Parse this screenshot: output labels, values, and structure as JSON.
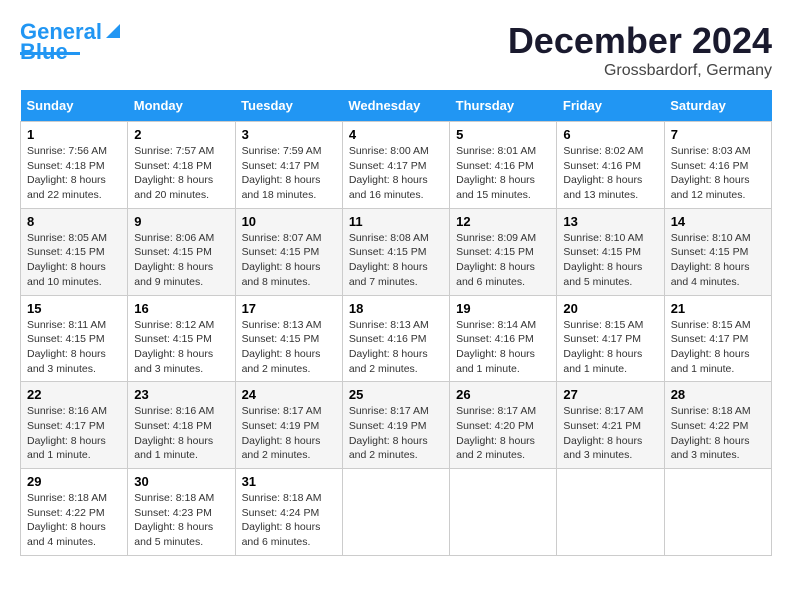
{
  "header": {
    "logo_line1": "General",
    "logo_line2": "Blue",
    "month": "December 2024",
    "location": "Grossbardorf, Germany"
  },
  "days_of_week": [
    "Sunday",
    "Monday",
    "Tuesday",
    "Wednesday",
    "Thursday",
    "Friday",
    "Saturday"
  ],
  "weeks": [
    [
      {
        "day": "1",
        "sunrise": "7:56 AM",
        "sunset": "4:18 PM",
        "daylight": "8 hours and 22 minutes."
      },
      {
        "day": "2",
        "sunrise": "7:57 AM",
        "sunset": "4:18 PM",
        "daylight": "8 hours and 20 minutes."
      },
      {
        "day": "3",
        "sunrise": "7:59 AM",
        "sunset": "4:17 PM",
        "daylight": "8 hours and 18 minutes."
      },
      {
        "day": "4",
        "sunrise": "8:00 AM",
        "sunset": "4:17 PM",
        "daylight": "8 hours and 16 minutes."
      },
      {
        "day": "5",
        "sunrise": "8:01 AM",
        "sunset": "4:16 PM",
        "daylight": "8 hours and 15 minutes."
      },
      {
        "day": "6",
        "sunrise": "8:02 AM",
        "sunset": "4:16 PM",
        "daylight": "8 hours and 13 minutes."
      },
      {
        "day": "7",
        "sunrise": "8:03 AM",
        "sunset": "4:16 PM",
        "daylight": "8 hours and 12 minutes."
      }
    ],
    [
      {
        "day": "8",
        "sunrise": "8:05 AM",
        "sunset": "4:15 PM",
        "daylight": "8 hours and 10 minutes."
      },
      {
        "day": "9",
        "sunrise": "8:06 AM",
        "sunset": "4:15 PM",
        "daylight": "8 hours and 9 minutes."
      },
      {
        "day": "10",
        "sunrise": "8:07 AM",
        "sunset": "4:15 PM",
        "daylight": "8 hours and 8 minutes."
      },
      {
        "day": "11",
        "sunrise": "8:08 AM",
        "sunset": "4:15 PM",
        "daylight": "8 hours and 7 minutes."
      },
      {
        "day": "12",
        "sunrise": "8:09 AM",
        "sunset": "4:15 PM",
        "daylight": "8 hours and 6 minutes."
      },
      {
        "day": "13",
        "sunrise": "8:10 AM",
        "sunset": "4:15 PM",
        "daylight": "8 hours and 5 minutes."
      },
      {
        "day": "14",
        "sunrise": "8:10 AM",
        "sunset": "4:15 PM",
        "daylight": "8 hours and 4 minutes."
      }
    ],
    [
      {
        "day": "15",
        "sunrise": "8:11 AM",
        "sunset": "4:15 PM",
        "daylight": "8 hours and 3 minutes."
      },
      {
        "day": "16",
        "sunrise": "8:12 AM",
        "sunset": "4:15 PM",
        "daylight": "8 hours and 3 minutes."
      },
      {
        "day": "17",
        "sunrise": "8:13 AM",
        "sunset": "4:15 PM",
        "daylight": "8 hours and 2 minutes."
      },
      {
        "day": "18",
        "sunrise": "8:13 AM",
        "sunset": "4:16 PM",
        "daylight": "8 hours and 2 minutes."
      },
      {
        "day": "19",
        "sunrise": "8:14 AM",
        "sunset": "4:16 PM",
        "daylight": "8 hours and 1 minute."
      },
      {
        "day": "20",
        "sunrise": "8:15 AM",
        "sunset": "4:17 PM",
        "daylight": "8 hours and 1 minute."
      },
      {
        "day": "21",
        "sunrise": "8:15 AM",
        "sunset": "4:17 PM",
        "daylight": "8 hours and 1 minute."
      }
    ],
    [
      {
        "day": "22",
        "sunrise": "8:16 AM",
        "sunset": "4:17 PM",
        "daylight": "8 hours and 1 minute."
      },
      {
        "day": "23",
        "sunrise": "8:16 AM",
        "sunset": "4:18 PM",
        "daylight": "8 hours and 1 minute."
      },
      {
        "day": "24",
        "sunrise": "8:17 AM",
        "sunset": "4:19 PM",
        "daylight": "8 hours and 2 minutes."
      },
      {
        "day": "25",
        "sunrise": "8:17 AM",
        "sunset": "4:19 PM",
        "daylight": "8 hours and 2 minutes."
      },
      {
        "day": "26",
        "sunrise": "8:17 AM",
        "sunset": "4:20 PM",
        "daylight": "8 hours and 2 minutes."
      },
      {
        "day": "27",
        "sunrise": "8:17 AM",
        "sunset": "4:21 PM",
        "daylight": "8 hours and 3 minutes."
      },
      {
        "day": "28",
        "sunrise": "8:18 AM",
        "sunset": "4:22 PM",
        "daylight": "8 hours and 3 minutes."
      }
    ],
    [
      {
        "day": "29",
        "sunrise": "8:18 AM",
        "sunset": "4:22 PM",
        "daylight": "8 hours and 4 minutes."
      },
      {
        "day": "30",
        "sunrise": "8:18 AM",
        "sunset": "4:23 PM",
        "daylight": "8 hours and 5 minutes."
      },
      {
        "day": "31",
        "sunrise": "8:18 AM",
        "sunset": "4:24 PM",
        "daylight": "8 hours and 6 minutes."
      },
      null,
      null,
      null,
      null
    ]
  ]
}
